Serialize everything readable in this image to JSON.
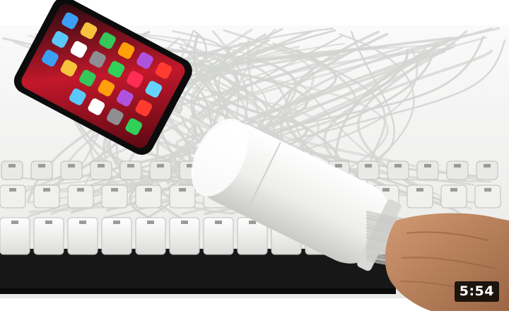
{
  "video": {
    "duration": "5:54"
  },
  "colors": {
    "backdrop": "#f4f4f2",
    "cable": "#d9dbd8",
    "charger": "#f6f6f4",
    "board": "#1a1a1a",
    "phone_screen": "#c2182b",
    "skin": "#b7805a"
  },
  "icons": {
    "duration_badge": "timestamp-badge"
  }
}
